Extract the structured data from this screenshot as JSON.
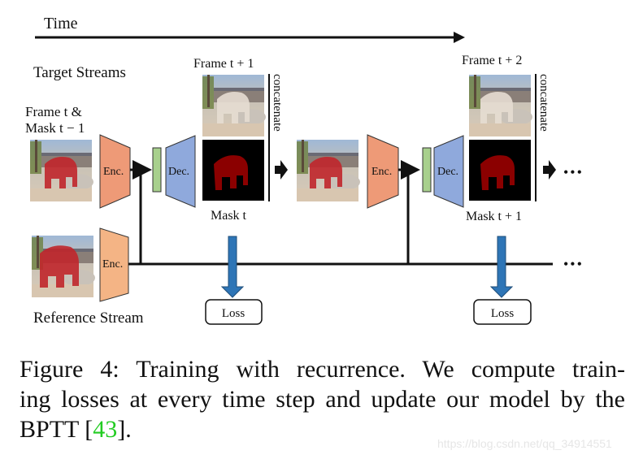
{
  "diagram": {
    "time_label": "Time",
    "target_streams_label": "Target Streams",
    "reference_stream_label": "Reference Stream",
    "input_label_line1": "Frame t &",
    "input_label_line2": "Mask t − 1",
    "step1": {
      "frame_label": "Frame t + 1",
      "mask_label": "Mask t",
      "concat_label": "concatenate",
      "encoder_label": "Enc.",
      "decoder_label": "Dec.",
      "loss_label": "Loss"
    },
    "step2": {
      "frame_label": "Frame t + 2",
      "mask_label": "Mask t + 1",
      "concat_label": "concatenate",
      "encoder_label": "Enc.",
      "decoder_label": "Dec.",
      "loss_label": "Loss"
    },
    "reference_encoder_label": "Enc.",
    "ellipsis": "•••",
    "colors": {
      "encoder_target": "#ee9a77",
      "encoder_reference": "#f4b485",
      "decoder": "#8fa9dc",
      "bottleneck": "#a8d08d",
      "loss_arrow": "#2e75b6",
      "mask_object": "#8b0000",
      "overlay_object": "#c0262b"
    }
  },
  "caption": {
    "line1": "Figure 4:  Training with recurrence.  We compute train-",
    "line2": "ing losses at every time step and update our model by the",
    "line3_prefix": "BPTT [",
    "citation": "43",
    "line3_suffix": "]."
  },
  "watermark": "https://blog.csdn.net/qq_34914551"
}
